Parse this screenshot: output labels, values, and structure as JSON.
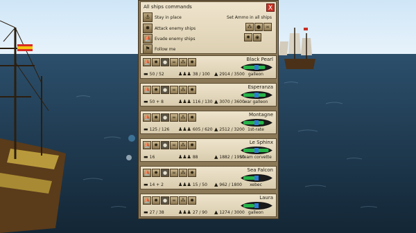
{
  "panel": {
    "title": "All ships commands",
    "close_glyph": "X",
    "commands": [
      {
        "label": "Stay in place",
        "icon": "anchor-icon",
        "glyph": "⚓"
      },
      {
        "label": "Attack enemy ships",
        "icon": "cannon-icon",
        "glyph": "✸"
      },
      {
        "label": "Evade enemy ships",
        "icon": "sail-icon",
        "glyph": "⛵"
      },
      {
        "label": "Follow me",
        "icon": "flag-icon",
        "glyph": "⚑"
      }
    ],
    "ammo_title": "Set Ammo in all ships",
    "ammo": [
      {
        "icon": "grape-shot-icon",
        "glyph": "⁂"
      },
      {
        "icon": "cannonball-icon",
        "glyph": "●"
      },
      {
        "icon": "chain-shot-icon",
        "glyph": "∞"
      },
      {
        "icon": "bomb-icon",
        "glyph": "✹"
      },
      {
        "icon": "shell-icon",
        "glyph": "◉"
      }
    ]
  },
  "ships": [
    {
      "name": "Black Pearl",
      "class": "galleon",
      "cannons": "50 / 52",
      "crew": "38 / 100",
      "hull": "2914 / 3500",
      "health": 0.83
    },
    {
      "name": "Esperanza",
      "class": "war galleon",
      "cannons": "50 + 8",
      "crew": "116 / 130",
      "hull": "3070 / 3600",
      "health": 0.85
    },
    {
      "name": "Montagne",
      "class": "1st-rate",
      "cannons": "125 / 126",
      "crew": "605 / 620",
      "hull": "2512 / 3200",
      "health": 0.78
    },
    {
      "name": "Le Sphinx",
      "class": "steam corvette",
      "cannons": "16",
      "crew": "88",
      "hull": "1882 / 1950",
      "health": 0.96
    },
    {
      "name": "Sea Falcon",
      "class": "xebec",
      "cannons": "14 + 2",
      "crew": "15 / 50",
      "hull": "962 / 1800",
      "health": 0.53
    },
    {
      "name": "Laura",
      "class": "galleon",
      "cannons": "27 / 38",
      "crew": "27 / 90",
      "hull": "1274 / 3000",
      "health": 0.42
    }
  ],
  "ship_buttons": [
    {
      "icon": "sail-icon",
      "glyph": "⛵"
    },
    {
      "icon": "cannon-icon",
      "glyph": "✸"
    },
    {
      "icon": "cannonball-icon",
      "glyph": "●"
    },
    {
      "icon": "chain-shot-icon",
      "glyph": "∞"
    },
    {
      "icon": "grape-shot-icon",
      "glyph": "⁂"
    },
    {
      "icon": "bomb-icon",
      "glyph": "✹"
    }
  ],
  "stat_icons": {
    "cannons": "▬",
    "crew": "♟♟♟",
    "hull": "▲"
  },
  "colors": {
    "panel": "#8a7856",
    "card": "#e7dcc2",
    "close": "#c43527",
    "health": "#27b34a"
  }
}
